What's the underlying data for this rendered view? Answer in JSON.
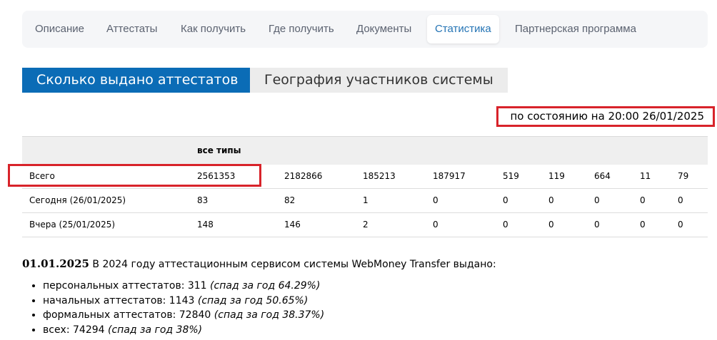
{
  "nav": {
    "tabs": [
      {
        "label": "Описание"
      },
      {
        "label": "Аттестаты"
      },
      {
        "label": "Как получить"
      },
      {
        "label": "Где получить"
      },
      {
        "label": "Документы"
      },
      {
        "label": "Статистика",
        "active": true
      },
      {
        "label": "Партнерская программа"
      }
    ]
  },
  "subtabs": {
    "issued": "Сколько выдано аттестатов",
    "geography": "География участников системы"
  },
  "asof": "по состоянию на 20:00 26/01/2025",
  "table": {
    "header": "все типы",
    "rows": [
      {
        "label": "Всего",
        "values": [
          "2561353",
          "2182866",
          "185213",
          "187917",
          "519",
          "119",
          "664",
          "11",
          "79"
        ]
      },
      {
        "label": "Сегодня (26/01/2025)",
        "values": [
          "83",
          "82",
          "1",
          "0",
          "0",
          "0",
          "0",
          "0",
          "0"
        ]
      },
      {
        "label": "Вчера (25/01/2025)",
        "values": [
          "148",
          "146",
          "2",
          "0",
          "0",
          "0",
          "0",
          "0",
          "0"
        ]
      }
    ]
  },
  "summary": {
    "date": "01.01.2025",
    "text": "В 2024 году аттестационным сервисом системы WebMoney Transfer выдано:",
    "items": [
      {
        "text": "персональных аттестатов: 311",
        "note": "(спад за год 64.29%)"
      },
      {
        "text": "начальных аттестатов: 1143",
        "note": "(спад за год 50.65%)"
      },
      {
        "text": "формальных аттестатов: 72840",
        "note": "(спад за год 38.37%)"
      },
      {
        "text": "всех: 74294",
        "note": "(спад за год 38%)"
      }
    ]
  },
  "colors": {
    "accent": "#0b6cb6",
    "active_tab_text": "#2474b5",
    "highlight_border": "#d8232a"
  }
}
